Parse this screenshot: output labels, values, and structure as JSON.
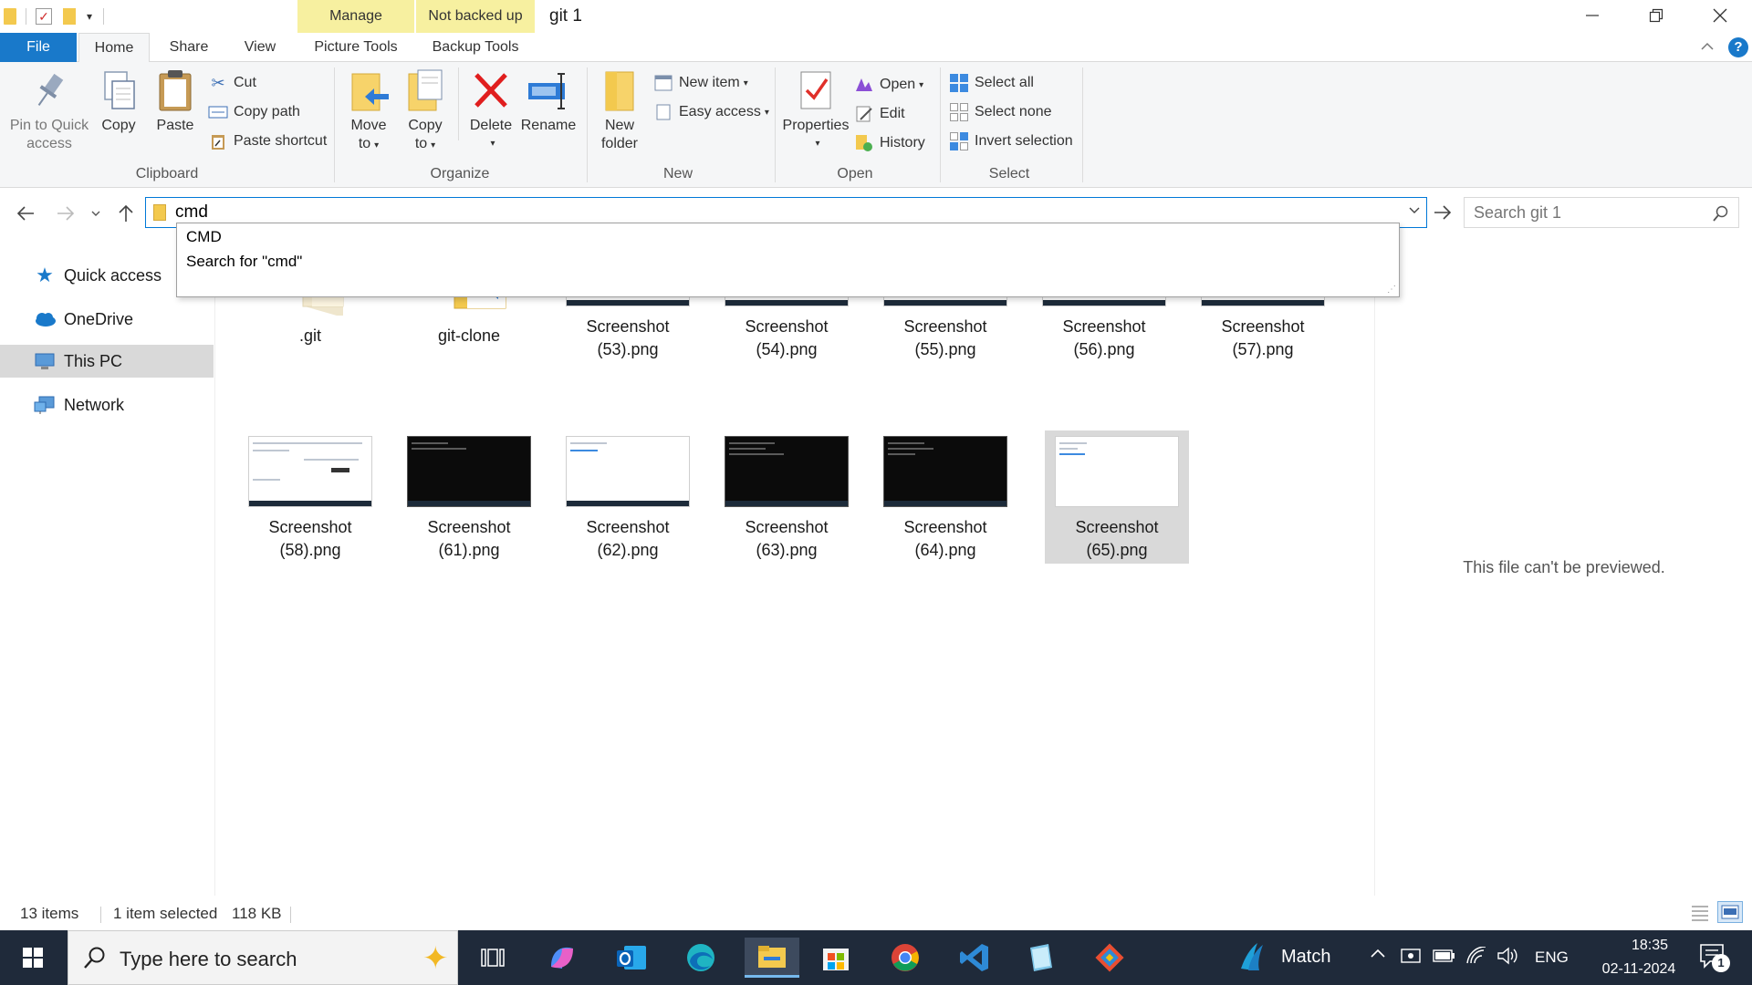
{
  "window": {
    "title": "git 1",
    "context_tabs": [
      "Manage",
      "Not backed up"
    ]
  },
  "ribbon_tabs": [
    "File",
    "Home",
    "Share",
    "View",
    "Picture Tools",
    "Backup Tools"
  ],
  "ribbon": {
    "clipboard": {
      "label": "Clipboard",
      "pin": [
        "Pin to Quick",
        "access"
      ],
      "copy": "Copy",
      "paste": "Paste",
      "cut": "Cut",
      "copy_path": "Copy path",
      "paste_shortcut": "Paste shortcut"
    },
    "organize": {
      "label": "Organize",
      "move_to": [
        "Move",
        "to"
      ],
      "copy_to": [
        "Copy",
        "to"
      ],
      "delete": "Delete",
      "rename": "Rename"
    },
    "new": {
      "label": "New",
      "new_folder": [
        "New",
        "folder"
      ],
      "new_item": "New item",
      "easy_access": "Easy access"
    },
    "open": {
      "label": "Open",
      "properties": "Properties",
      "open": "Open",
      "edit": "Edit",
      "history": "History"
    },
    "select": {
      "label": "Select",
      "select_all": "Select all",
      "select_none": "Select none",
      "invert": "Invert selection"
    }
  },
  "address": {
    "value": "cmd",
    "suggestions": [
      "CMD",
      "Search for \"cmd\""
    ]
  },
  "search": {
    "placeholder": "Search git 1"
  },
  "nav_pane": {
    "items": [
      {
        "label": "Quick access",
        "icon": "star-icon"
      },
      {
        "label": "OneDrive",
        "icon": "cloud-icon"
      },
      {
        "label": "This PC",
        "icon": "computer-icon",
        "selected": true
      },
      {
        "label": "Network",
        "icon": "network-icon"
      }
    ]
  },
  "files": [
    {
      "name": ".git",
      "kind": "folder"
    },
    {
      "name": "git-clone",
      "kind": "vscode-folder"
    },
    {
      "name": [
        "Screenshot",
        "(53).png"
      ],
      "kind": "light"
    },
    {
      "name": [
        "Screenshot",
        "(54).png"
      ],
      "kind": "light"
    },
    {
      "name": [
        "Screenshot",
        "(55).png"
      ],
      "kind": "light"
    },
    {
      "name": [
        "Screenshot",
        "(56).png"
      ],
      "kind": "light"
    },
    {
      "name": [
        "Screenshot",
        "(57).png"
      ],
      "kind": "light"
    },
    {
      "name": [
        "Screenshot",
        "(58).png"
      ],
      "kind": "light"
    },
    {
      "name": [
        "Screenshot",
        "(61).png"
      ],
      "kind": "dark"
    },
    {
      "name": [
        "Screenshot",
        "(62).png"
      ],
      "kind": "light"
    },
    {
      "name": [
        "Screenshot",
        "(63).png"
      ],
      "kind": "dark"
    },
    {
      "name": [
        "Screenshot",
        "(64).png"
      ],
      "kind": "dark"
    },
    {
      "name": [
        "Screenshot",
        "(65).png"
      ],
      "kind": "light",
      "selected": true
    }
  ],
  "preview": {
    "message": "This file can't be previewed."
  },
  "status": {
    "count": "13 items",
    "selected": "1 item selected",
    "size": "118 KB"
  },
  "taskbar": {
    "search_placeholder": "Type here to search",
    "weather": "Match",
    "language": "ENG",
    "time": "18:35",
    "date": "02-11-2024",
    "notifications": "1"
  },
  "colors": {
    "accent": "#1979ca",
    "context_tab": "#f7f0a0",
    "selection": "#d9d9d9",
    "taskbar": "#1f2a3a"
  }
}
